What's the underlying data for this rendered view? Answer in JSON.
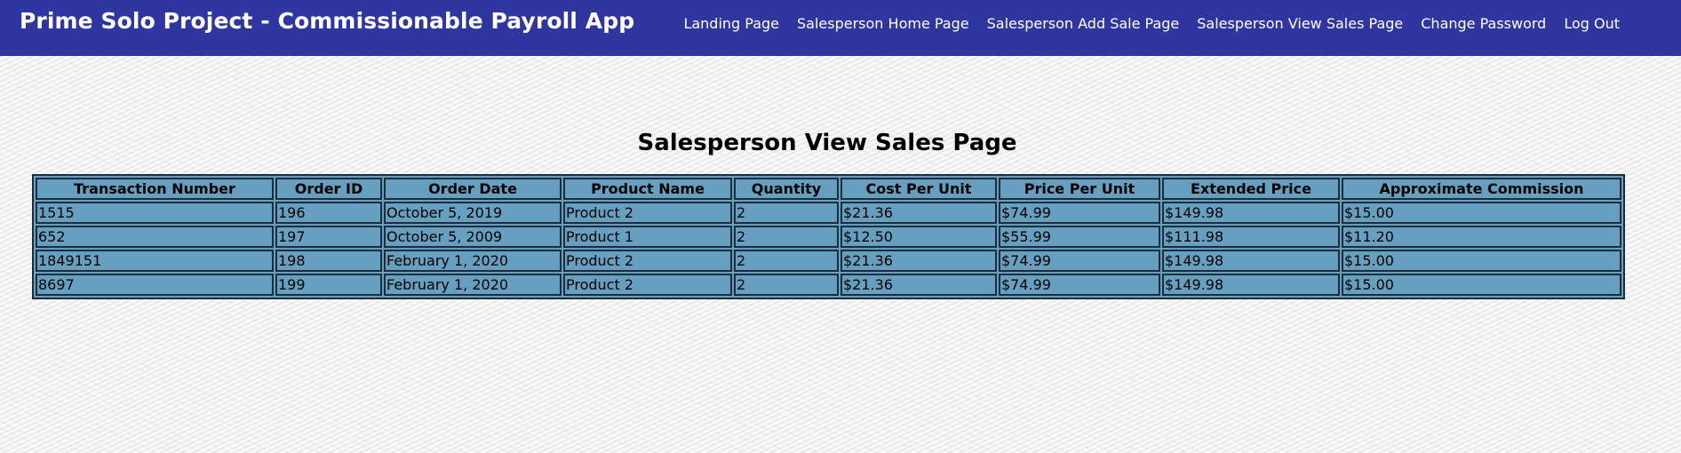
{
  "header": {
    "title": "Prime Solo Project - Commissionable Payroll App",
    "nav_links": [
      "Landing Page",
      "Salesperson Home Page",
      "Salesperson Add Sale Page",
      "Salesperson View Sales Page",
      "Change Password",
      "Log Out"
    ]
  },
  "main": {
    "heading": "Salesperson View Sales Page",
    "table": {
      "columns": [
        "Transaction Number",
        "Order ID",
        "Order Date",
        "Product Name",
        "Quantity",
        "Cost Per Unit",
        "Price Per Unit",
        "Extended Price",
        "Approximate Commission"
      ],
      "rows": [
        [
          "1515",
          "196",
          "October 5, 2019",
          "Product 2",
          "2",
          "$21.36",
          "$74.99",
          "$149.98",
          "$15.00"
        ],
        [
          "652",
          "197",
          "October 5, 2009",
          "Product 1",
          "2",
          "$12.50",
          "$55.99",
          "$111.98",
          "$11.20"
        ],
        [
          "1849151",
          "198",
          "February 1, 2020",
          "Product 2",
          "2",
          "$21.36",
          "$74.99",
          "$149.98",
          "$15.00"
        ],
        [
          "8697",
          "199",
          "February 1, 2020",
          "Product 2",
          "2",
          "$21.36",
          "$74.99",
          "$149.98",
          "$15.00"
        ]
      ]
    }
  },
  "colors": {
    "nav_background": "#3036a0",
    "table_background": "#669fc0",
    "table_border": "#1b2e3d",
    "page_background": "#efefef"
  }
}
